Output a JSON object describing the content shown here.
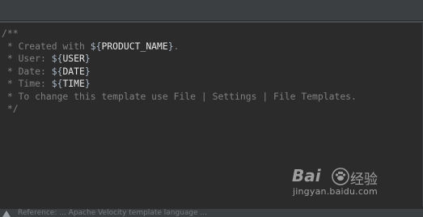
{
  "editor": {
    "lines": [
      {
        "parts": [
          {
            "text": "/**",
            "kind": "cm"
          }
        ]
      },
      {
        "parts": [
          {
            "text": " * Created with ",
            "kind": "cm"
          },
          {
            "text": "${",
            "kind": "tpl"
          },
          {
            "text": "PRODUCT_NAME",
            "kind": "vname"
          },
          {
            "text": "}",
            "kind": "tpl"
          },
          {
            "text": ".",
            "kind": "cm"
          }
        ]
      },
      {
        "parts": [
          {
            "text": " * User: ",
            "kind": "cm"
          },
          {
            "text": "${",
            "kind": "tpl"
          },
          {
            "text": "USER",
            "kind": "vname"
          },
          {
            "text": "}",
            "kind": "tpl"
          }
        ]
      },
      {
        "parts": [
          {
            "text": " * Date: ",
            "kind": "cm"
          },
          {
            "text": "${",
            "kind": "tpl"
          },
          {
            "text": "DATE",
            "kind": "vname"
          },
          {
            "text": "}",
            "kind": "tpl"
          }
        ]
      },
      {
        "parts": [
          {
            "text": " * Time: ",
            "kind": "cm"
          },
          {
            "text": "${",
            "kind": "tpl"
          },
          {
            "text": "TIME",
            "kind": "vname"
          },
          {
            "text": "}",
            "kind": "tpl"
          }
        ]
      },
      {
        "parts": [
          {
            "text": " * To change this template use File | Settings | File Templates.",
            "kind": "cm"
          }
        ]
      },
      {
        "parts": [
          {
            "text": " */",
            "kind": "cm"
          }
        ]
      }
    ]
  },
  "watermark": {
    "logo": "Bai",
    "brand_cn": "经验",
    "url": "jingyan.baidu.com"
  },
  "status_bar": {
    "hint_text": "Reference: ... Apache Velocity template language ..."
  },
  "colors": {
    "background": "#2b2b2b",
    "comment": "#808080",
    "template_brace": "#a9b7c6",
    "variable": "#e8e8e8"
  }
}
